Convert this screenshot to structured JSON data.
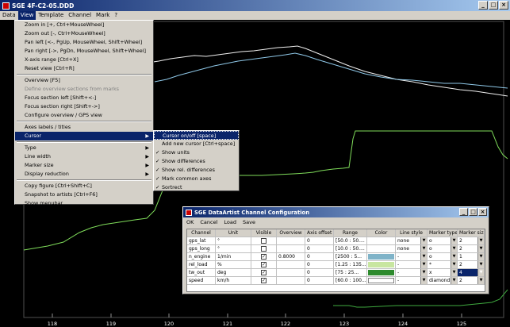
{
  "window": {
    "title": "SGE  4F-C2-05.DDD",
    "controls": [
      "_",
      "□",
      "×"
    ]
  },
  "menubar": [
    "Data",
    "View",
    "Template",
    "Channel",
    "Mark",
    "?"
  ],
  "view_menu": [
    {
      "label": "Zoom in [+, Ctrl+MouseWheel]",
      "disabled": false
    },
    {
      "label": "Zoom out [-, Ctrl+MouseWheel]",
      "disabled": false
    },
    {
      "label": "Pan left [<-, PgUp, MouseWheel, Shift+Wheel]",
      "disabled": false
    },
    {
      "label": "Pan right [->, PgDn, MouseWheel, Shift+Wheel]",
      "disabled": false
    },
    {
      "label": "X-axis range [Ctrl+X]",
      "disabled": false
    },
    {
      "label": "Reset view [Ctrl+R]",
      "disabled": false,
      "sep_after": true
    },
    {
      "label": "Overview [F5]",
      "disabled": false
    },
    {
      "label": "Define overview sections from marks",
      "disabled": true
    },
    {
      "label": "Focus section left [Shift+<-]",
      "disabled": false
    },
    {
      "label": "Focus section right [Shift+->]",
      "disabled": false
    },
    {
      "label": "Configure overview / GPS view",
      "disabled": false,
      "sep_after": true
    },
    {
      "label": "Axes labels / titles",
      "disabled": false
    },
    {
      "label": "Cursor",
      "disabled": false,
      "submenu": true,
      "active": true,
      "sep_after": true
    },
    {
      "label": "Type",
      "disabled": false,
      "submenu": true
    },
    {
      "label": "Line width",
      "disabled": false,
      "submenu": true
    },
    {
      "label": "Marker size",
      "disabled": false,
      "submenu": true
    },
    {
      "label": "Display reduction",
      "disabled": false,
      "submenu": true,
      "sep_after": true
    },
    {
      "label": "Copy figure [Ctrl+Shift+C]",
      "disabled": false
    },
    {
      "label": "Snapshot to artists [Ctrl+F6]",
      "disabled": false
    },
    {
      "label": "Show menubar",
      "disabled": false
    }
  ],
  "cursor_submenu": [
    {
      "label": "Cursor on/off [space]",
      "checked": false,
      "active": true
    },
    {
      "label": "Add new cursor [Ctrl+space]",
      "checked": false
    },
    {
      "label": "Show units",
      "checked": true
    },
    {
      "label": "Show differences",
      "checked": true
    },
    {
      "label": "Show rel. differences",
      "checked": true
    },
    {
      "label": "Mark common axes",
      "checked": true
    },
    {
      "label": "Sortrect",
      "checked": true
    }
  ],
  "dialog": {
    "title": "SGE DataArtist Channel Configuration",
    "menu": [
      "OK",
      "Cancel",
      "Load",
      "Save"
    ],
    "columns": [
      "Channel",
      "Unit",
      "Visible",
      "Overview",
      "Axis offset",
      "Range",
      "Color",
      "Line style",
      "Marker type",
      "Marker size"
    ],
    "rows": [
      {
        "channel": "gps_lat",
        "unit": "°",
        "visible": false,
        "overview": "",
        "offset": "0",
        "range": "[50.0 : 50....",
        "color": "",
        "linestyle": "none",
        "marker": "o",
        "msize": "2"
      },
      {
        "channel": "gps_long",
        "unit": "°",
        "visible": false,
        "overview": "",
        "offset": "0",
        "range": "[10.0 : 50....",
        "color": "",
        "linestyle": "none",
        "marker": "o",
        "msize": "2"
      },
      {
        "channel": "n_engine",
        "unit": "1/min",
        "visible": true,
        "overview": "0.8000",
        "offset": "0",
        "range": "[2500 : 5...",
        "color": "#7fb3c8",
        "linestyle": "-",
        "marker": "o",
        "msize": "1"
      },
      {
        "channel": "rel_load",
        "unit": "%",
        "visible": true,
        "overview": "",
        "offset": "0",
        "range": "[1.25 : 135...",
        "color": "#c8e6a0",
        "linestyle": "-",
        "marker": "*",
        "msize": "2"
      },
      {
        "channel": "tw_out",
        "unit": "deg",
        "visible": true,
        "overview": "",
        "offset": "0",
        "range": "[75 : 25...",
        "color": "#2e8b2e",
        "linestyle": "-",
        "marker": "x",
        "msize": "4"
      },
      {
        "channel": "speed",
        "unit": "km/h",
        "visible": true,
        "overview": "",
        "offset": "0",
        "range": "[60.0 : 100...",
        "color": "#ffffff",
        "linestyle": "-",
        "marker": "diamond",
        "msize": "2"
      }
    ]
  },
  "x_axis_ticks": [
    "118",
    "119",
    "120",
    "121",
    "122",
    "123",
    "124",
    "125"
  ],
  "colors": {
    "plot_bg": "#000000",
    "trace_white": "#f0f0f0",
    "trace_blue": "#8fc8e8",
    "trace_green": "#7fdc5a",
    "trace_dkgreen": "#3faa3f"
  }
}
